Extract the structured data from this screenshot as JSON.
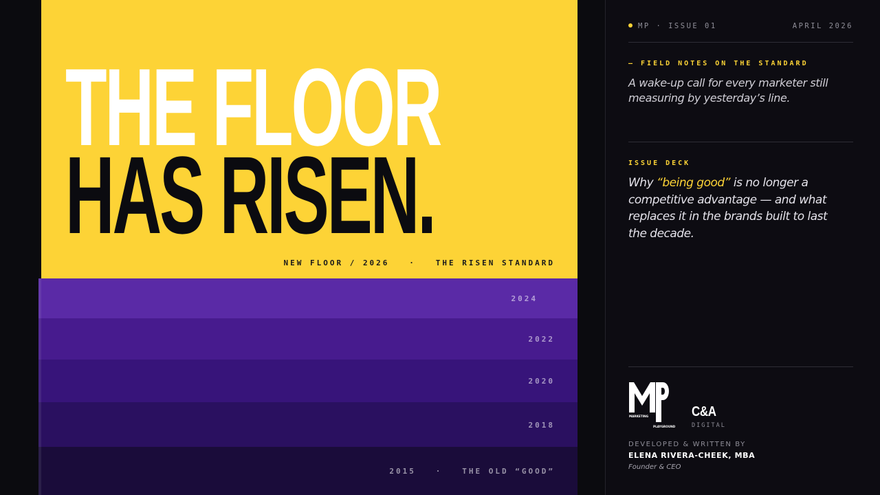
{
  "colors": {
    "accent": "#fdd336",
    "background": "#0b0b0f",
    "headline_light": "#ffffff",
    "headline_dark": "#0b0b10"
  },
  "hero": {
    "headline_line1": "THE FLOOR",
    "headline_line2": "HAS RISEN.",
    "tagline": "NEW FLOOR / 2026   ·   THE RISEN STANDARD"
  },
  "bands": [
    {
      "label": "2024",
      "color": "#5a2aa6"
    },
    {
      "label": "2022",
      "color": "#471b8e"
    },
    {
      "label": "2020",
      "color": "#37147a"
    },
    {
      "label": "2018",
      "color": "#2a1060"
    },
    {
      "label": "2015   ·   THE OLD “GOOD”",
      "color": "#1a0c3a"
    }
  ],
  "sidebar": {
    "issue": "MP · ISSUE 01",
    "date": "APRIL 2026",
    "field_label": "— FIELD NOTES ON THE STANDARD",
    "field_note": "A wake-up call for every marketer still measuring by yesterday’s line.",
    "deck_label": "ISSUE DECK",
    "deck_before": "Why ",
    "deck_highlight": "“being good”",
    "deck_after": " is no longer a competitive advantage — and what replaces it in the brands built to last the decade.",
    "logo": {
      "icon": "mp-logo-icon",
      "top_text": "MARKETING",
      "bottom_text": "PLAYGROUND"
    },
    "partner": {
      "name": "C&A",
      "sub": "DIGITAL"
    },
    "credit_label": "DEVELOPED & WRITTEN BY",
    "author": "ELENA RIVERA-CHEEK, MBA",
    "role": "Founder & CEO"
  }
}
